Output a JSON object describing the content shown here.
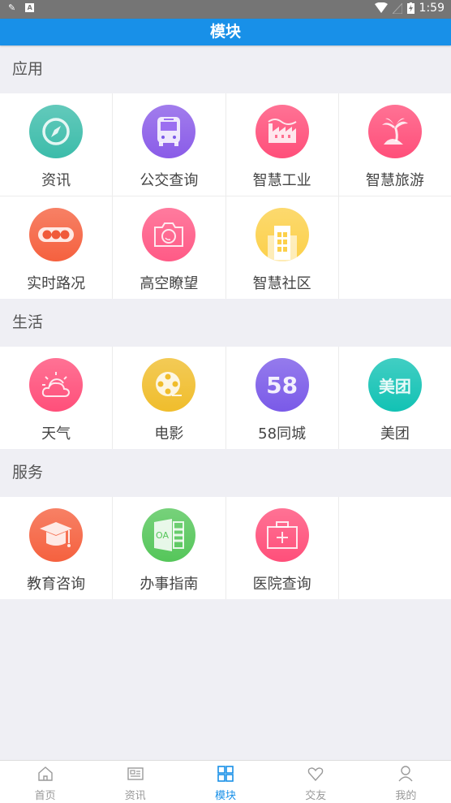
{
  "status_bar": {
    "time": "1:59",
    "icon_a": "A"
  },
  "app_bar": {
    "title": "模块"
  },
  "sections": [
    {
      "title": "应用",
      "items": [
        {
          "label": "资讯",
          "icon": "compass-icon",
          "color": "#3cbcaa"
        },
        {
          "label": "公交查询",
          "icon": "bus-icon",
          "color": "#8a5ce8"
        },
        {
          "label": "智慧工业",
          "icon": "factory-icon",
          "color": "#ff4f7a"
        },
        {
          "label": "智慧旅游",
          "icon": "palm-tree-icon",
          "color": "#ff4f7a"
        },
        {
          "label": "实时路况",
          "icon": "traffic-light-icon",
          "color": "#f5613f"
        },
        {
          "label": "高空瞭望",
          "icon": "camera-icon",
          "color": "#ff5a86"
        },
        {
          "label": "智慧社区",
          "icon": "building-icon",
          "color": "#fcd04a"
        }
      ]
    },
    {
      "title": "生活",
      "items": [
        {
          "label": "天气",
          "icon": "weather-icon",
          "color": "#ff4f7a"
        },
        {
          "label": "电影",
          "icon": "film-reel-icon",
          "color": "#f0bd2c"
        },
        {
          "label": "58同城",
          "icon": "58-icon",
          "color": "#7a5ae8",
          "text": "58"
        },
        {
          "label": "美团",
          "icon": "meituan-icon",
          "color": "#12c2b4",
          "text": "美团"
        }
      ]
    },
    {
      "title": "服务",
      "items": [
        {
          "label": "教育咨询",
          "icon": "graduation-cap-icon",
          "color": "#f5613f"
        },
        {
          "label": "办事指南",
          "icon": "oa-document-icon",
          "color": "#55c65a",
          "text": "OA"
        },
        {
          "label": "医院查询",
          "icon": "medical-kit-icon",
          "color": "#ff4f7a"
        }
      ]
    }
  ],
  "tabs": [
    {
      "label": "首页",
      "icon": "home-icon"
    },
    {
      "label": "资讯",
      "icon": "news-icon"
    },
    {
      "label": "模块",
      "icon": "grid-icon",
      "active": true
    },
    {
      "label": "交友",
      "icon": "heart-icon"
    },
    {
      "label": "我的",
      "icon": "user-icon"
    }
  ]
}
